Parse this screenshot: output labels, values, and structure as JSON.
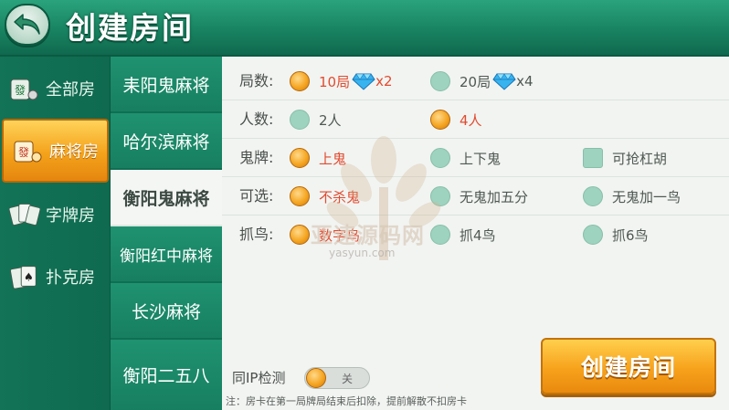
{
  "header": {
    "title": "创建房间"
  },
  "categories": [
    {
      "label": "全部房",
      "icon": "mahjong-tile-icon",
      "active": false
    },
    {
      "label": "麻将房",
      "icon": "mahjong-tile-icon",
      "active": true
    },
    {
      "label": "字牌房",
      "icon": "word-cards-icon",
      "active": false
    },
    {
      "label": "扑克房",
      "icon": "poker-cards-icon",
      "active": false
    }
  ],
  "games": [
    {
      "label": "耒阳鬼麻将",
      "active": false
    },
    {
      "label": "哈尔滨麻将",
      "active": false
    },
    {
      "label": "衡阳鬼麻将",
      "active": true
    },
    {
      "label": "衡阳红中麻将",
      "active": false
    },
    {
      "label": "长沙麻将",
      "active": false
    },
    {
      "label": "衡阳二五八",
      "active": false
    }
  ],
  "options": {
    "rounds": {
      "label": "局数:",
      "choices": [
        {
          "text": "10局",
          "mult": "x2",
          "selected": true
        },
        {
          "text": "20局",
          "mult": "x4",
          "selected": false
        }
      ]
    },
    "players": {
      "label": "人数:",
      "choices": [
        {
          "text": "2人",
          "selected": false
        },
        {
          "text": "4人",
          "selected": true
        }
      ]
    },
    "ghost": {
      "label": "鬼牌:",
      "choices": [
        {
          "text": "上鬼",
          "selected": true
        },
        {
          "text": "上下鬼",
          "selected": false
        },
        {
          "text": "可抢杠胡",
          "selected": false,
          "type": "checkbox"
        }
      ]
    },
    "optional": {
      "label": "可选:",
      "choices": [
        {
          "text": "不杀鬼",
          "selected": true
        },
        {
          "text": "无鬼加五分",
          "selected": false
        },
        {
          "text": "无鬼加一鸟",
          "selected": false
        }
      ]
    },
    "birds": {
      "label": "抓鸟:",
      "choices": [
        {
          "text": "数字鸟",
          "selected": true
        },
        {
          "text": "抓4鸟",
          "selected": false
        },
        {
          "text": "抓6鸟",
          "selected": false
        }
      ]
    }
  },
  "ip_check": {
    "label": "同IP检测",
    "state": "关"
  },
  "note": "注：房卡在第一局牌局结束后扣除，提前解散不扣房卡",
  "create_button": {
    "label": "创建房间"
  },
  "watermark": {
    "text": "亚速源码网",
    "sub": "yasyun.com"
  },
  "colors": {
    "header_green": "#17805f",
    "selected_text": "#e24b2e",
    "accent_orange": "#f5a623",
    "radio_off": "#9dd3bf"
  }
}
